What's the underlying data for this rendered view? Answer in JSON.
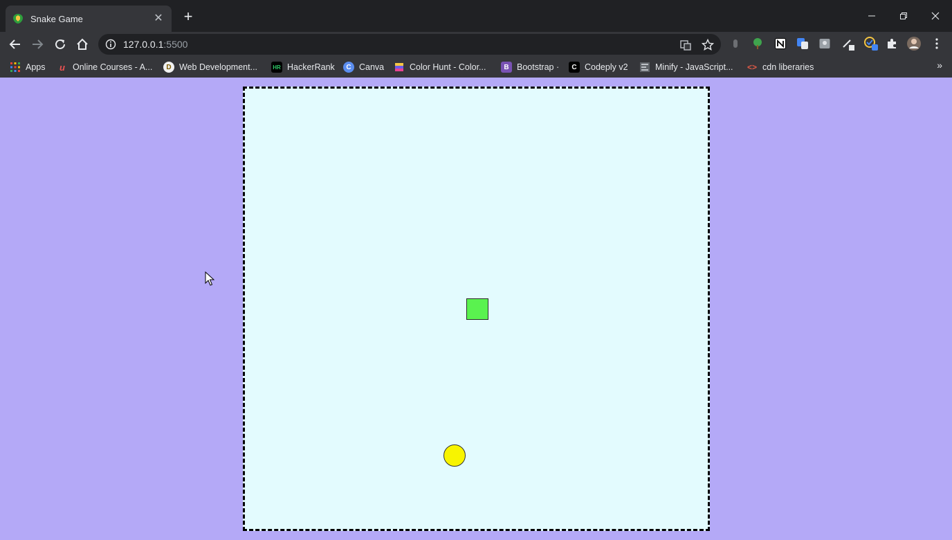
{
  "browser": {
    "tab": {
      "title": "Snake Game",
      "close": "✕",
      "favicon": "snake-favicon-icon"
    },
    "new_tab": "+",
    "window": {
      "minimize": "minimize-icon",
      "restore": "restore-icon",
      "close": "close-icon"
    },
    "url": {
      "host": "127.0.0.1",
      "port": ":5500"
    },
    "bookmarks": [
      {
        "label": "Apps",
        "icon": "apps-grid-icon"
      },
      {
        "label": "Online Courses - A...",
        "icon": "udemy-icon"
      },
      {
        "label": "Web Development...",
        "icon": "web-dev-icon"
      },
      {
        "label": "HackerRank",
        "icon": "hackerrank-icon"
      },
      {
        "label": "Canva",
        "icon": "canva-icon"
      },
      {
        "label": "Color Hunt - Color...",
        "icon": "colorhunt-icon"
      },
      {
        "label": "Bootstrap ·",
        "icon": "bootstrap-icon"
      },
      {
        "label": "Codeply v2",
        "icon": "codeply-icon"
      },
      {
        "label": "Minify - JavaScript...",
        "icon": "minify-icon"
      },
      {
        "label": "cdn liberaries",
        "icon": "code-brackets-icon"
      }
    ],
    "bookmarks_overflow": "»"
  },
  "game": {
    "board_color": "#e3fbfe",
    "page_color": "#b4a9f7",
    "snake_color": "#5af24f",
    "food_color": "#f8f400"
  }
}
